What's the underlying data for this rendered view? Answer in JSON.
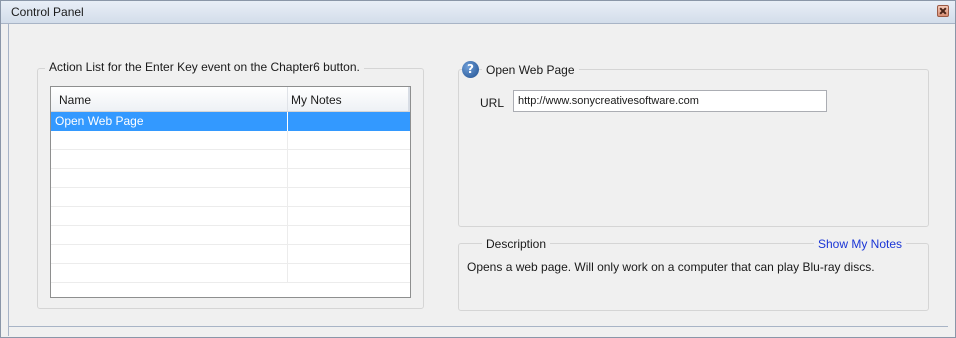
{
  "window": {
    "title": "Control Panel"
  },
  "actions": {
    "group_label": "Action List for the Enter Key event on the Chapter6 button.",
    "columns": [
      "Name",
      "My Notes"
    ],
    "rows": [
      {
        "name": "Open Web Page",
        "notes": "",
        "selected": true
      }
    ]
  },
  "details": {
    "title": "Open Web Page",
    "url_label": "URL",
    "url_value": "http://www.sonycreativesoftware.com"
  },
  "description": {
    "title": "Description",
    "show_notes_label": "Show My Notes",
    "text": "Opens a web page.  Will only work on a computer that can play Blu-ray discs."
  },
  "colors": {
    "selection": "#3399ff",
    "link": "#1a35d6"
  }
}
